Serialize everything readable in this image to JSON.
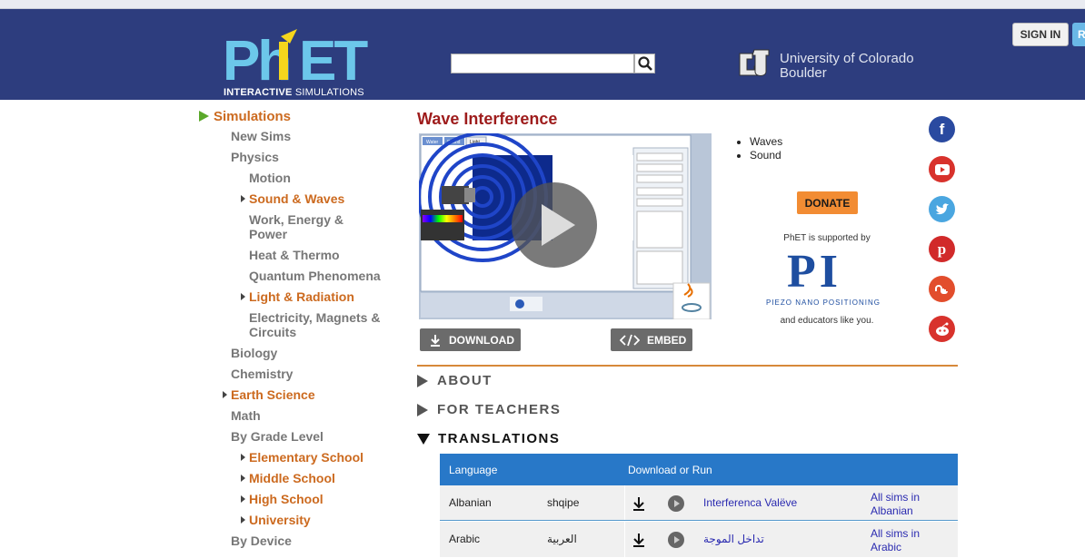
{
  "header": {
    "logo_main": "PhET",
    "logo_sub_bold": "INTERACTIVE",
    "logo_sub": "SIMULATIONS",
    "university": "University of Colorado",
    "university_line2": "Boulder",
    "sign_in": "SIGN IN",
    "register_partial": "R",
    "search_placeholder": "",
    "search_icon": "magnifier-icon"
  },
  "sidebar": {
    "items": [
      {
        "label": "Simulations",
        "style": "top"
      },
      {
        "label": "New Sims"
      },
      {
        "label": "Physics"
      },
      {
        "label": "Motion"
      },
      {
        "label": "Sound & Waves",
        "style": "orange"
      },
      {
        "label": "Work, Energy &"
      },
      {
        "label": "Power"
      },
      {
        "label": "Heat & Thermo"
      },
      {
        "label": "Quantum Phenomena"
      },
      {
        "label": "Light & Radiation",
        "style": "orange"
      },
      {
        "label": "Electricity, Magnets &"
      },
      {
        "label": "Circuits"
      },
      {
        "label": "Biology"
      },
      {
        "label": "Chemistry"
      },
      {
        "label": "Earth Science",
        "style": "orange"
      },
      {
        "label": "Math"
      },
      {
        "label": "By Grade Level"
      },
      {
        "label": "Elementary School",
        "style": "orange"
      },
      {
        "label": "Middle School",
        "style": "orange"
      },
      {
        "label": "High School",
        "style": "orange"
      },
      {
        "label": "University",
        "style": "orange"
      },
      {
        "label": "By Device"
      }
    ]
  },
  "sim": {
    "title": "Wave Interference",
    "topics": [
      "Waves",
      "Sound"
    ],
    "download_label": "DOWNLOAD",
    "embed_label": "EMBED",
    "thumb_tabs": [
      "Water",
      "Sound",
      "Light"
    ]
  },
  "sponsor": {
    "donate": "DONATE",
    "supported_by": "PhET is supported by",
    "pi_letters": "PI",
    "pi_words": "PIEZO  NANO  POSITIONING",
    "educators": "and educators like you."
  },
  "social": [
    "facebook-icon",
    "youtube-icon",
    "twitter-icon",
    "pinterest-icon",
    "stumbleupon-icon",
    "reddit-icon"
  ],
  "sections": {
    "about": "ABOUT",
    "teachers": "FOR TEACHERS",
    "translations": "TRANSLATIONS"
  },
  "translations_table": {
    "col_language": "Language",
    "col_download": "Download or Run",
    "rows": [
      {
        "language": "Albanian",
        "native": "shqipe",
        "sim_name": "Interferenca Valëve",
        "all_sims_1": "All sims in",
        "all_sims_2": "Albanian"
      },
      {
        "language": "Arabic",
        "native": "العربية",
        "sim_name": "تداخل الموجة",
        "all_sims_1": "All sims in",
        "all_sims_2": "Arabic"
      }
    ]
  },
  "colors": {
    "header_bg": "#2d3d7e",
    "title_red": "#9e1c1c",
    "nav_orange": "#cc6a1f",
    "table_header": "#2878c8",
    "donate": "#f28c33"
  }
}
